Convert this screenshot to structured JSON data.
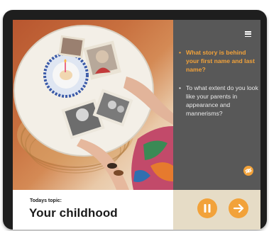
{
  "topic": {
    "label": "Todays topic:",
    "title": "Your childhood"
  },
  "questions": [
    {
      "bullet": "•",
      "text": "What story is behind your first name and last name?",
      "active": true
    },
    {
      "bullet": "•",
      "text": "To what extent do you look like your parents in appearance and mannerisms?",
      "active": false
    }
  ],
  "icons": {
    "menu": "hamburger-menu-icon",
    "visibility": "eye-off-icon",
    "pause": "pause-icon",
    "next": "arrow-right-icon"
  },
  "colors": {
    "accent": "#f2a23a",
    "panel": "#585858",
    "controls_bg": "#e6dcc6",
    "question_text": "#e9e9e9"
  }
}
